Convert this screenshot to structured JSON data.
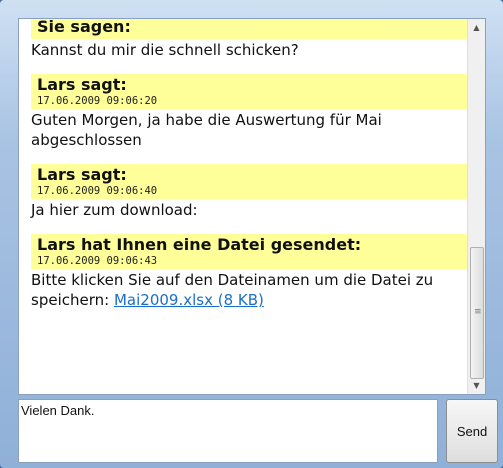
{
  "messages": [
    {
      "sender": "Sie sagen:",
      "timestamp": "",
      "text": "Kannst du mir die schnell schicken?"
    },
    {
      "sender": "Lars sagt:",
      "timestamp": "17.06.2009 09:06:20",
      "text": "Guten Morgen, ja habe die Auswertung für Mai abgeschlossen"
    },
    {
      "sender": "Lars sagt:",
      "timestamp": "17.06.2009 09:06:40",
      "text": "Ja hier zum download:"
    },
    {
      "sender": "Lars hat Ihnen eine Datei gesendet:",
      "timestamp": "17.06.2009 09:06:43",
      "text": "Bitte klicken Sie auf den Dateinamen um die Datei zu speichern:",
      "link": "Mai2009.xlsx (8 KB)"
    }
  ],
  "input": {
    "value": "Vielen Dank."
  },
  "send_label": "Send",
  "icons": {
    "scroll_up": "scroll-up-arrow",
    "scroll_down": "scroll-down-arrow"
  }
}
